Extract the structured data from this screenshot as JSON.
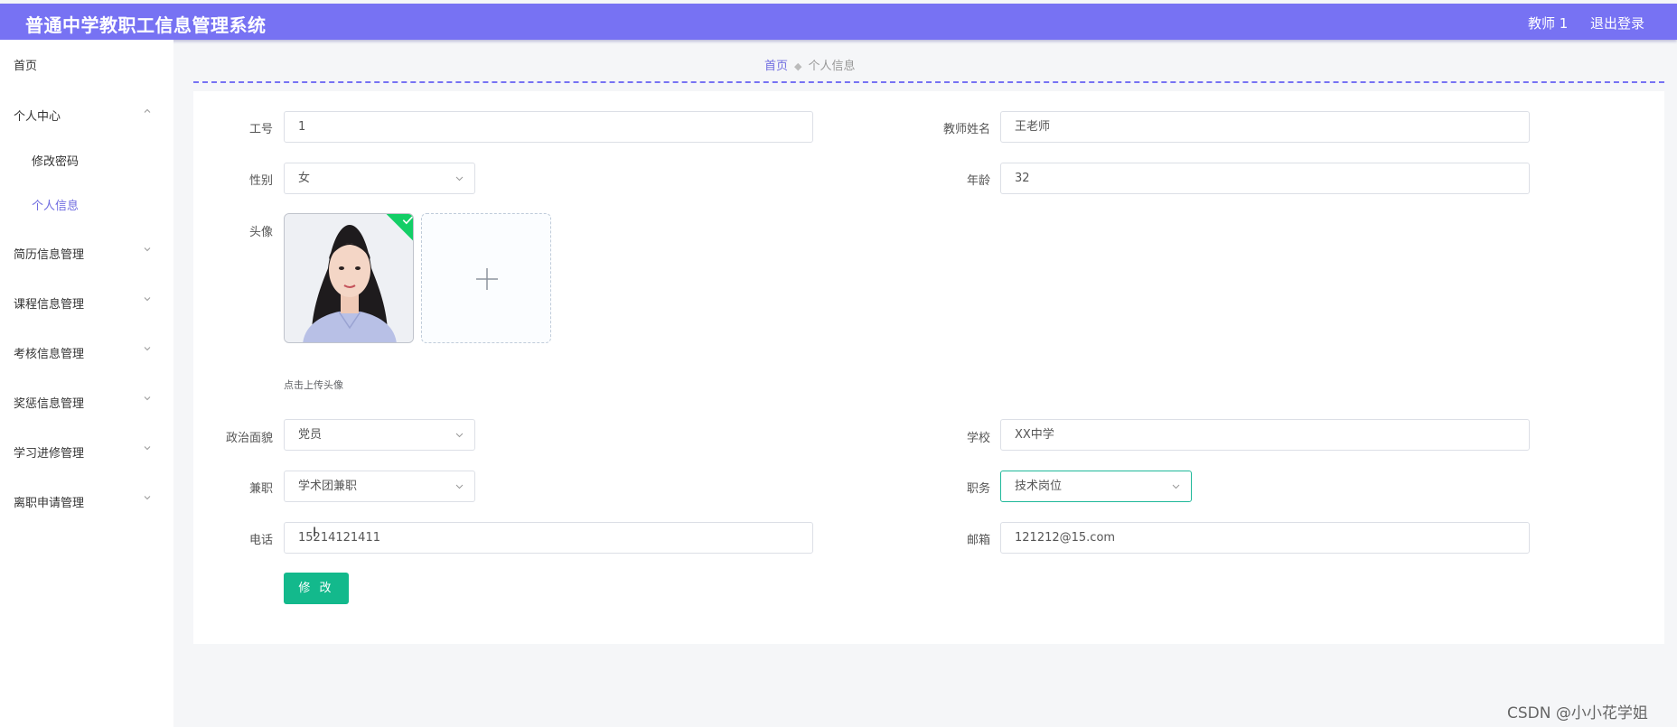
{
  "header": {
    "title": "普通中学教职工信息管理系统",
    "user": "教师 1",
    "logout": "退出登录"
  },
  "sidebar": {
    "items": [
      {
        "label": "首页",
        "chevron": ""
      },
      {
        "label": "个人中心",
        "chevron": "chevron-up"
      },
      {
        "label": "修改密码",
        "chevron": ""
      },
      {
        "label": "个人信息",
        "chevron": ""
      },
      {
        "label": "简历信息管理",
        "chevron": "chevron-down"
      },
      {
        "label": "课程信息管理",
        "chevron": "chevron-down"
      },
      {
        "label": "考核信息管理",
        "chevron": "chevron-down"
      },
      {
        "label": "奖惩信息管理",
        "chevron": "chevron-down"
      },
      {
        "label": "学习进修管理",
        "chevron": "chevron-down"
      },
      {
        "label": "离职申请管理",
        "chevron": "chevron-down"
      }
    ]
  },
  "breadcrumb": {
    "home": "首页",
    "current": "个人信息"
  },
  "form": {
    "gonghao": {
      "label": "工号",
      "value": "1"
    },
    "name": {
      "label": "教师姓名",
      "value": "王老师"
    },
    "gender": {
      "label": "性别",
      "value": "女"
    },
    "age": {
      "label": "年龄",
      "value": "32"
    },
    "avatar": {
      "label": "头像",
      "hint": "点击上传头像"
    },
    "politics": {
      "label": "政治面貌",
      "value": "党员"
    },
    "school": {
      "label": "学校",
      "value": "XX中学"
    },
    "parttime": {
      "label": "兼职",
      "value": "学术团兼职"
    },
    "position": {
      "label": "职务",
      "value": "技术岗位"
    },
    "phone": {
      "label": "电话",
      "value": "15214121411"
    },
    "email": {
      "label": "邮箱",
      "value": "121212@15.com"
    },
    "submit": "修 改"
  },
  "watermark": "CSDN @小小花学姐",
  "colors": {
    "header": "#7772f3",
    "accent": "#6f6ce0",
    "button": "#13b98c",
    "success": "#13ce66"
  }
}
